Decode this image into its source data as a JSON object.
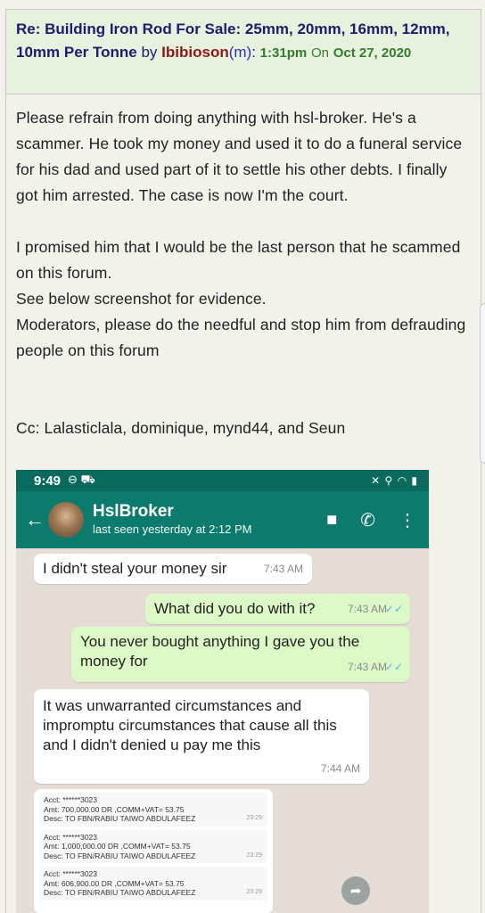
{
  "post": {
    "title": "Re: Building Iron Rod For Sale: 25mm, 20mm, 16mm, 12mm, 10mm Per Tonne",
    "by": "by",
    "author": "Ibibioson",
    "gender": "(m)",
    "colon": ":",
    "time": "1:31pm",
    "on": "On",
    "date": "Oct 27, 2020",
    "body": {
      "p1": "Please refrain from doing anything with hsl-broker. He's a scammer. He took my money and used it to do a funeral service for his dad and used part of it to settle his other debts. I finally got him arrested. The case is now I'm the court.",
      "p2": "I promised him that I would be the last person that he scammed on this forum.",
      "p3": "See below screenshot for evidence.",
      "p4": "Moderators, please do the needful and stop him from defrauding people on this forum",
      "cc": "Cc: Lalasticlala, dominique, mynd44, and Seun"
    }
  },
  "whatsapp": {
    "status_time": "9:49",
    "status_left_icons": "⊖ ⛟",
    "status_right_icons": "✕ ⚲ ◠ ▮",
    "contact_name": "HslBroker",
    "last_seen": "last seen yesterday at 2:12 PM",
    "back_icon": "←",
    "video_icon": "■",
    "call_icon": "✆",
    "menu_icon": "⋮",
    "messages": [
      {
        "text": "I didn't steal your money sir",
        "time": "7:43 AM",
        "direction": "in"
      },
      {
        "text": "What did you do with it?",
        "time": "7:43 AM",
        "direction": "out",
        "ticks": "✓✓"
      },
      {
        "text": "You never bought anything I gave you the money for",
        "time": "7:43 AM",
        "direction": "out",
        "ticks": "✓✓"
      },
      {
        "text": "It was unwarranted circumstances and impromptu circumstances that cause all this and I didn't denied u pay me this",
        "time": "7:44 AM",
        "direction": "in"
      }
    ],
    "receipts": [
      {
        "acct": "Acct: ******3023",
        "amt": "Amt: 700,000.00 DR ,COMM+VAT= 53.75",
        "desc": "Desc: TO FBN/RABIU TAIWO ABDULAFEEZ",
        "time": "23:29"
      },
      {
        "acct": "Acct: ******3023",
        "amt": "Amt: 1,000,000.00 DR ,COMM+VAT= 53.75",
        "desc": "Desc: TO FBN/RABIU TAIWO ABDULAFEEZ",
        "time": "23:29"
      },
      {
        "acct": "Acct: ******3023",
        "amt": "Amt: 606,900.00 DR ,COMM+VAT= 53.75",
        "desc": "Desc: TO FBN/RABIU TAIWO ABDULAFEEZ",
        "time": "23:29"
      }
    ],
    "forward_icon": "➦"
  }
}
